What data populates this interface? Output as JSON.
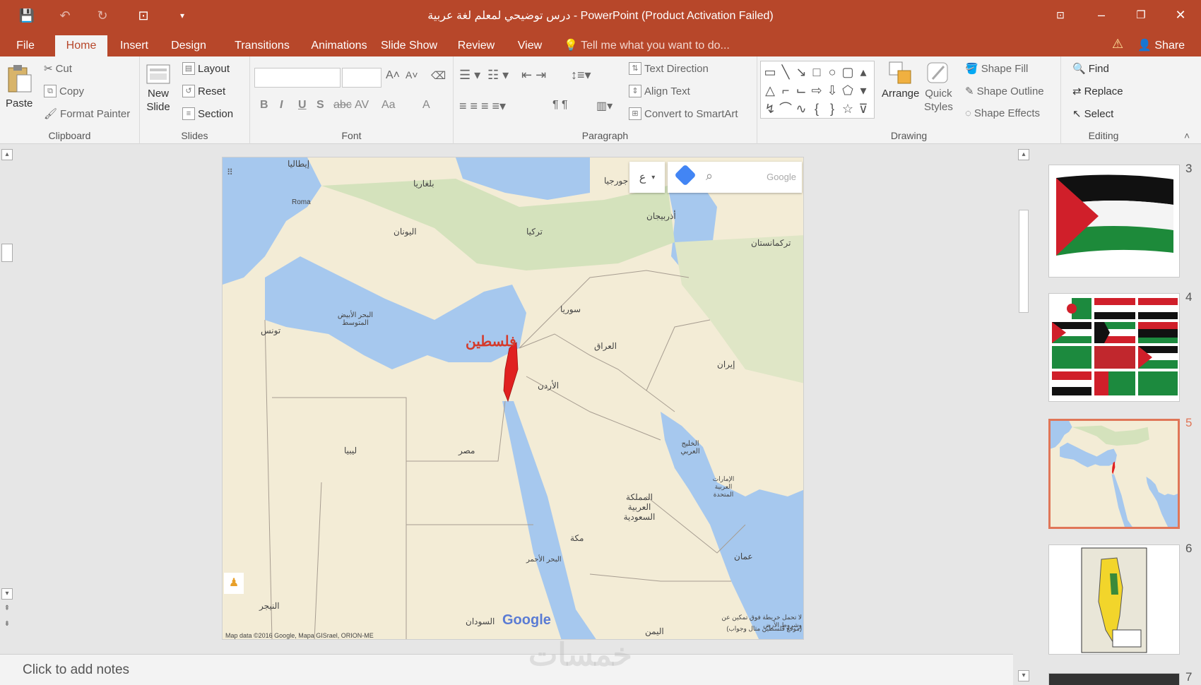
{
  "window": {
    "title": "درس توضيحي لمعلم لغة عربية - PowerPoint (Product Activation Failed)",
    "minimize": "–",
    "restore": "❐",
    "close": "✕",
    "ribbon_display": "⊡"
  },
  "qat": {
    "save_icon": "💾",
    "undo_icon": "↶",
    "redo_icon": "↻",
    "present_icon": "⊡",
    "customize_icon": "▾"
  },
  "tabs": [
    "File",
    "Home",
    "Insert",
    "Design",
    "Transitions",
    "Animations",
    "Slide Show",
    "Review",
    "View"
  ],
  "active_tab": "Home",
  "tell_me": "Tell me what you want to do...",
  "share": "Share",
  "ribbon": {
    "clipboard": {
      "label": "Clipboard",
      "paste": "Paste",
      "cut": "Cut",
      "copy": "Copy",
      "format_painter": "Format Painter"
    },
    "slides": {
      "label": "Slides",
      "new_slide_line1": "New",
      "new_slide_line2": "Slide",
      "layout": "Layout",
      "reset": "Reset",
      "section": "Section"
    },
    "font": {
      "label": "Font",
      "bold": "B",
      "italic": "I",
      "underline": "U",
      "shadow": "S",
      "strike": "abc",
      "spacing": "AV",
      "case": "Aa",
      "color": "A",
      "grow": "A˄",
      "shrink": "A˅"
    },
    "paragraph": {
      "label": "Paragraph",
      "text_direction": "Text Direction",
      "align_text": "Align Text",
      "convert_smartart": "Convert to SmartArt"
    },
    "drawing": {
      "label": "Drawing",
      "arrange": "Arrange",
      "quick_styles_line1": "Quick",
      "quick_styles_line2": "Styles",
      "shape_fill": "Shape Fill",
      "shape_outline": "Shape Outline",
      "shape_effects": "Shape Effects"
    },
    "editing": {
      "label": "Editing",
      "find": "Find",
      "replace": "Replace",
      "select": "Select"
    }
  },
  "map": {
    "palestine": "فلسطين",
    "search_placeholder": "Google",
    "google_logo": "Google",
    "attribution": "Map data ©2016 Google, Mapa GISrael, ORION-ME",
    "labels": {
      "turkey": "تركيا",
      "syria": "سوريا",
      "iraq": "العراق",
      "iran": "إيران",
      "libya": "ليبيا",
      "egypt": "مصر",
      "saudi": "المملكة العربية السعودية",
      "sudan": "السودان",
      "yemen": "اليمن",
      "oman": "عمان",
      "jordan": "الأردن",
      "greece": "اليونان",
      "italy": "إيطاليا",
      "bulgaria": "بلغاريا",
      "georgia": "جورجيا",
      "azerbaijan": "أذربيجان",
      "turkmenistan": "تركمانستان",
      "tunisia": "تونس",
      "niger": "النيجر",
      "mecca": "مكة",
      "rome": "Roma",
      "mediterranean": "البحر الأبيض المتوسط",
      "gulf": "الخليج العربي",
      "uae": "الإمارات العربية المتحدة",
      "red_sea": "البحر الأحمر"
    },
    "caption_line1": "لا تحمل خريطة فوق تمكين عن وشروط الأرض",
    "caption_line2": "(موقع فلسطين مثال وجواب)"
  },
  "notes": {
    "placeholder": "Click to add notes"
  },
  "watermark": "خمسات",
  "thumbnails": [
    {
      "number": "3"
    },
    {
      "number": "4"
    },
    {
      "number": "5",
      "selected": true
    },
    {
      "number": "6"
    },
    {
      "number": "7"
    }
  ],
  "colors": {
    "accent": "#b7472a",
    "ribbon_bg": "#f3f3f3",
    "selection": "#e07658"
  }
}
